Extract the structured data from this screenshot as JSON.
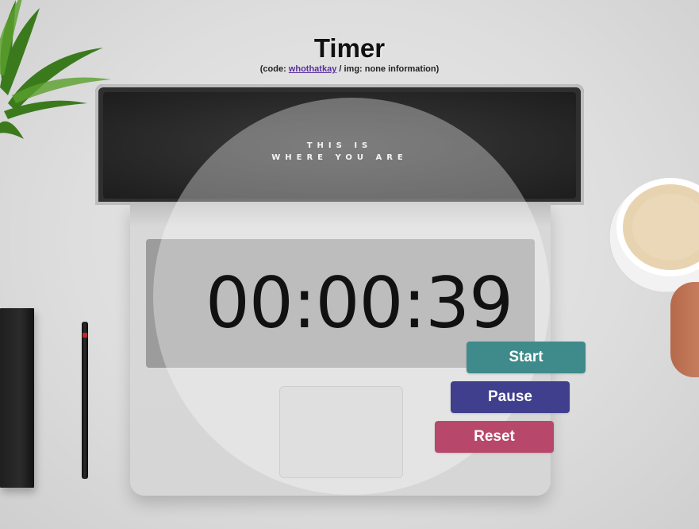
{
  "header": {
    "title": "Timer",
    "credits_prefix": "(code: ",
    "credits_author": "whothatkay",
    "credits_suffix": " / img: none information)"
  },
  "laptop_screen": {
    "line1": "THIS IS",
    "line2": "WHERE YOU ARE"
  },
  "timer": {
    "display": "00:00:39"
  },
  "buttons": {
    "start": {
      "label": "Start",
      "color": "#3f8a8b"
    },
    "pause": {
      "label": "Pause",
      "color": "#3f3f8e"
    },
    "reset": {
      "label": "Reset",
      "color": "#b8486b"
    }
  }
}
